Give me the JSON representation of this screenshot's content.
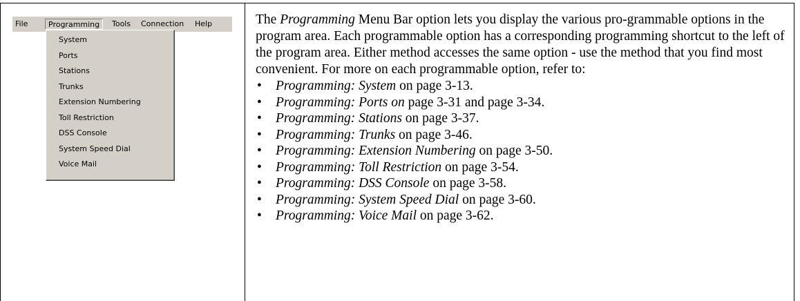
{
  "menubar": {
    "items": [
      {
        "label": "File"
      },
      {
        "label": "Programming"
      },
      {
        "label": "Tools"
      },
      {
        "label": "Connection"
      },
      {
        "label": "Help"
      }
    ],
    "active_index": 1
  },
  "dropdown": {
    "items": [
      {
        "label": "System"
      },
      {
        "label": "Ports"
      },
      {
        "label": "Stations"
      },
      {
        "label": "Trunks"
      },
      {
        "label": "Extension Numbering"
      },
      {
        "label": "Toll Restriction"
      },
      {
        "label": "DSS Console"
      },
      {
        "label": "System Speed Dial"
      },
      {
        "label": "Voice Mail"
      }
    ]
  },
  "text": {
    "intro_pre": "The ",
    "intro_em": "Programming",
    "intro_post": " Menu Bar option lets you display the various pro-grammable options in the program area. Each programmable option has a corresponding programming shortcut to the left of the program area. Either method accesses the same option - use the method that you find most convenient. For more on each programmable option, refer to:",
    "bullet_char": "•",
    "bullets": [
      {
        "em": "Programming: System",
        "rest": " on page 3-13."
      },
      {
        "em": "Programming: Ports on",
        "rest": " page 3-31 and page 3-34."
      },
      {
        "em": "Programming: Stations",
        "rest": " on page 3-37."
      },
      {
        "em": "Programming: Trunks",
        "rest": " on page 3-46."
      },
      {
        "em": "Programming: Extension Numbering",
        "rest": " on page 3-50."
      },
      {
        "em": "Programming: Toll Restriction",
        "rest": " on page 3-54."
      },
      {
        "em": "Programming: DSS Console",
        "rest": " on page 3-58."
      },
      {
        "em": "Programming: System Speed Dial",
        "rest": " on page 3-60."
      },
      {
        "em": "Programming: Voice Mail",
        "rest": " on page 3-62."
      }
    ]
  }
}
